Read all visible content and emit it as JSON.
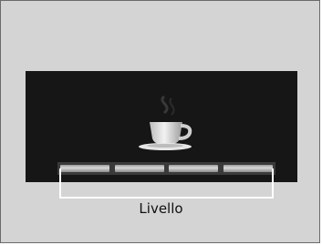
{
  "display": {
    "icon": "coffee-cup-icon",
    "level_segments_filled": 4,
    "level_segments_total": 4
  },
  "callout": {
    "label": "Livello"
  },
  "colors": {
    "frame_background": "#d4d4d4",
    "screen_background": "#161616",
    "callout_line": "#ffffff"
  }
}
